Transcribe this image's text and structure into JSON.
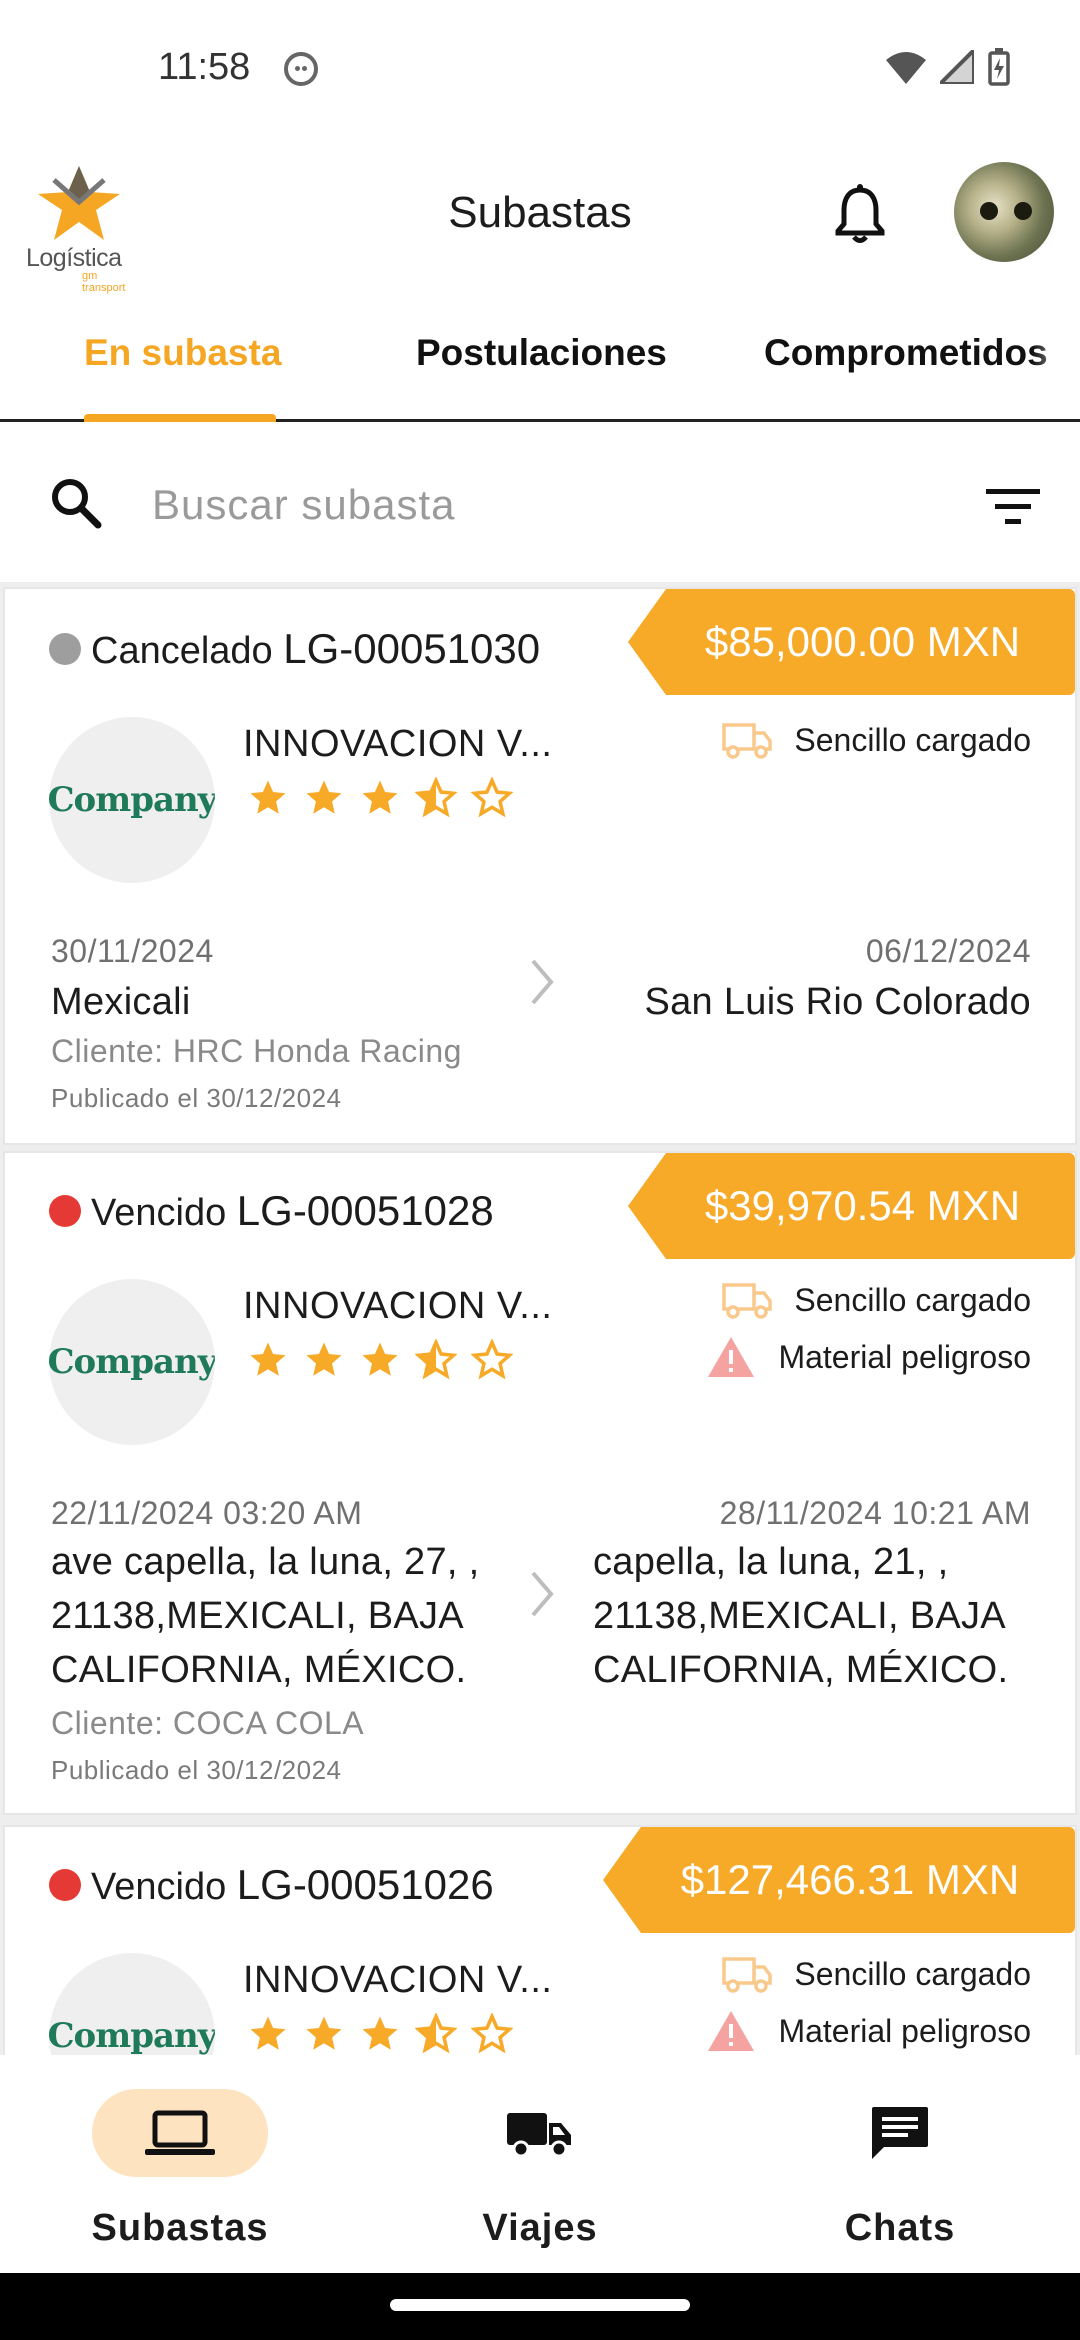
{
  "status_bar": {
    "time": "11:58"
  },
  "header": {
    "logo_text": "Logística",
    "logo_sub": "gm transport",
    "title": "Subastas"
  },
  "tabs": [
    {
      "label": "En subasta",
      "active": true
    },
    {
      "label": "Postulaciones",
      "active": false
    },
    {
      "label": "Comprometidos",
      "active": false
    }
  ],
  "search": {
    "placeholder": "Buscar subasta",
    "value": ""
  },
  "cards": [
    {
      "status": "Cancelado",
      "status_color": "#9e9e9e",
      "code": "LG-00051030",
      "price": "$85,000.00 MXN",
      "company_logo_text": "Company",
      "company": "INNOVACION V...",
      "rating": 3.5,
      "attributes": [
        "Sencillo cargado"
      ],
      "origin_date": "30/11/2024",
      "origin": "Mexicali",
      "dest_date": "06/12/2024",
      "destination": "San Luis Rio Colorado",
      "client": "Cliente: HRC Honda Racing",
      "published": "Publicado el 30/12/2024"
    },
    {
      "status": "Vencido",
      "status_color": "#e53935",
      "code": "LG-00051028",
      "price": "$39,970.54 MXN",
      "company_logo_text": "Company",
      "company": "INNOVACION V...",
      "rating": 3.5,
      "attributes": [
        "Sencillo cargado",
        "Material peligroso"
      ],
      "origin_date": "22/11/2024 03:20 AM",
      "origin": "ave capella, la luna, 27, , 21138,MEXICALI, BAJA CALIFORNIA, MÉXICO.",
      "dest_date": "28/11/2024 10:21 AM",
      "destination": "capella, la luna, 21, , 21138,MEXICALI, BAJA CALIFORNIA, MÉXICO.",
      "client": "Cliente: COCA COLA",
      "published": "Publicado el 30/12/2024"
    },
    {
      "status": "Vencido",
      "status_color": "#e53935",
      "code": "LG-00051026",
      "price": "$127,466.31 MXN",
      "company_logo_text": "Company",
      "company": "INNOVACION V...",
      "rating": 3.5,
      "attributes": [
        "Sencillo cargado",
        "Material peligroso"
      ]
    }
  ],
  "bottom_nav": [
    {
      "label": "Subastas",
      "icon": "laptop-icon",
      "active": true
    },
    {
      "label": "Viajes",
      "icon": "truck-icon",
      "active": false
    },
    {
      "label": "Chats",
      "icon": "chat-icon",
      "active": false
    }
  ],
  "colors": {
    "accent": "#f7a928",
    "accent_light": "#fde3c0",
    "cancel": "#9e9e9e",
    "expired": "#e53935"
  }
}
